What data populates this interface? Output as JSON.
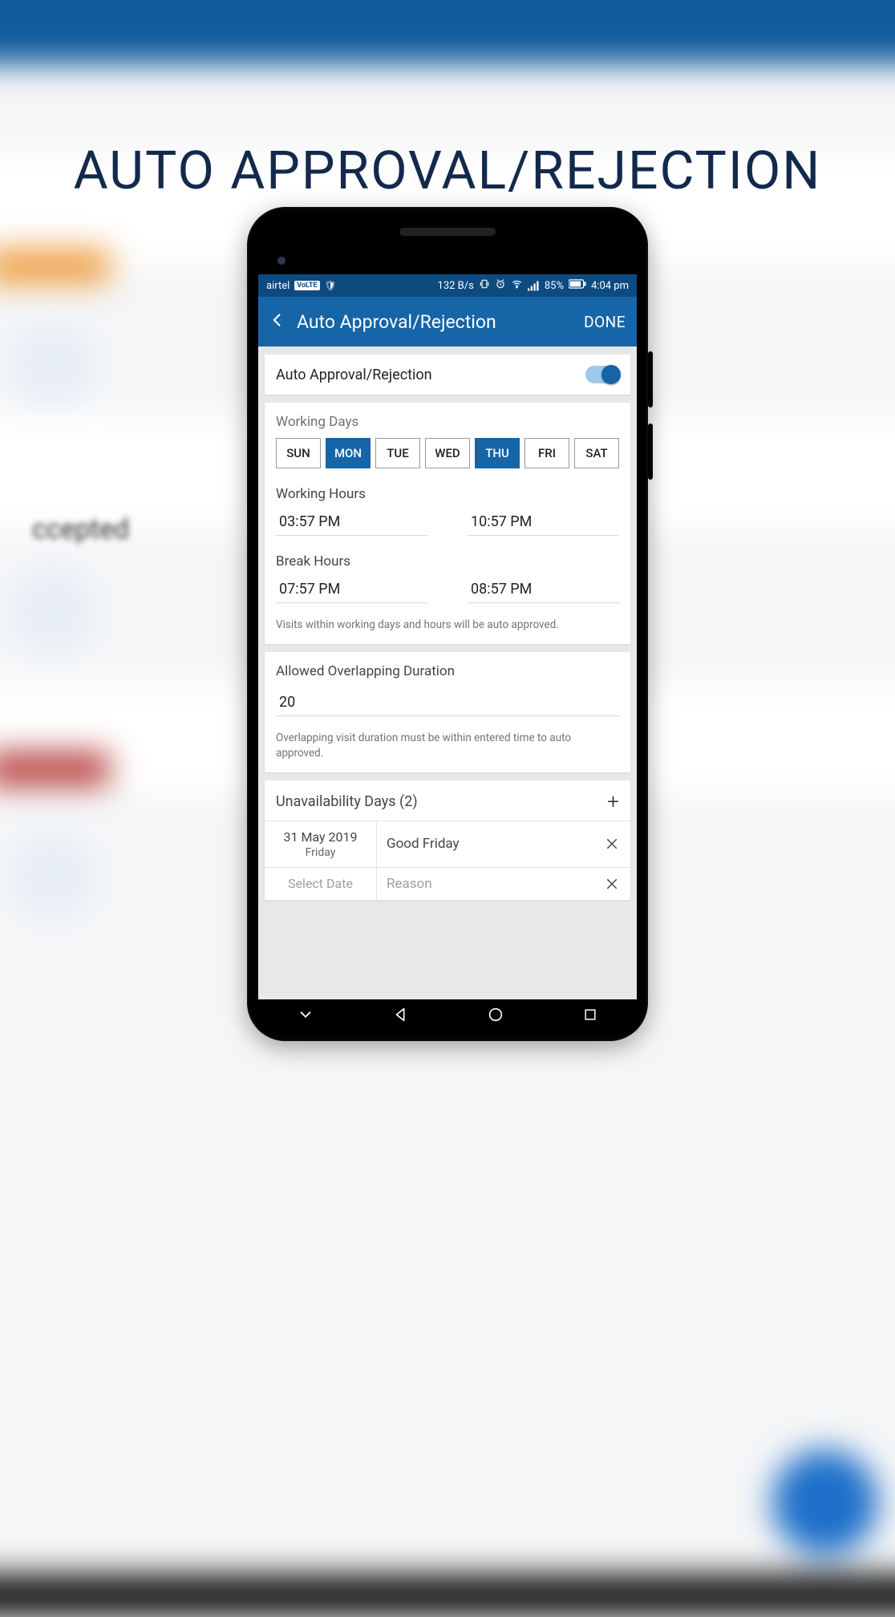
{
  "headline": "AUTO APPROVAL/REJECTION",
  "blurred_accepted_label": "ccepted",
  "status": {
    "carrier": "airtel",
    "volte": "VoLTE",
    "data_rate": "132 B/s",
    "battery": "85%",
    "time": "4:04 pm"
  },
  "appbar": {
    "title": "Auto Approval/Rejection",
    "done": "DONE"
  },
  "toggle": {
    "label": "Auto Approval/Rejection",
    "on": true
  },
  "working": {
    "days_title": "Working Days",
    "days": [
      "SUN",
      "MON",
      "TUE",
      "WED",
      "THU",
      "FRI",
      "SAT"
    ],
    "active_days": [
      "MON",
      "THU"
    ],
    "hours_title": "Working Hours",
    "hours_start": "03:57 PM",
    "hours_end": "10:57 PM",
    "break_title": "Break Hours",
    "break_start": "07:57 PM",
    "break_end": "08:57 PM",
    "hint": "Visits within working days and hours will be auto approved."
  },
  "overlap": {
    "title": "Allowed Overlapping Duration",
    "value": "20",
    "hint": "Overlapping visit duration must be within entered time to auto approved."
  },
  "unavail": {
    "title": "Unavailability Days (2)",
    "rows": [
      {
        "date": "31 May 2019",
        "day": "Friday",
        "reason": "Good Friday",
        "placeholder": false
      },
      {
        "date": "Select Date",
        "day": "",
        "reason": "Reason",
        "placeholder": true
      }
    ]
  }
}
